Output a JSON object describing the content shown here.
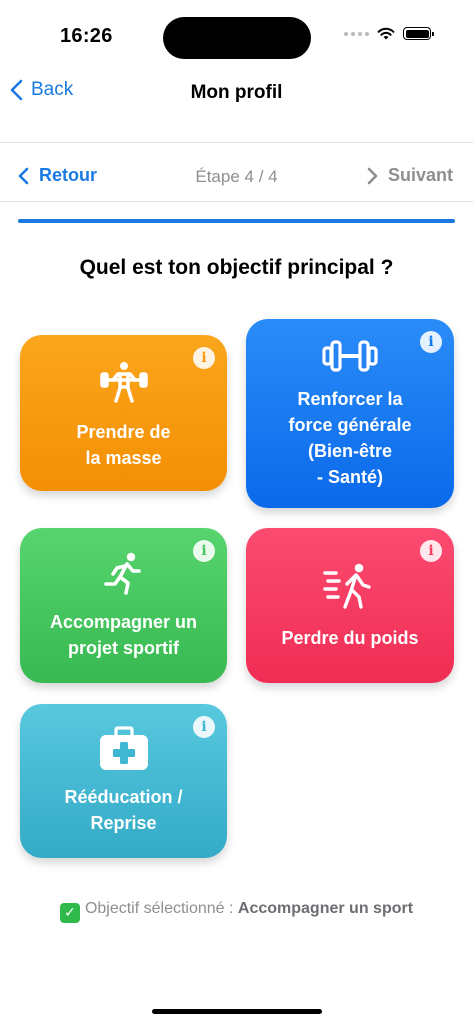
{
  "status_bar": {
    "time": "16:26"
  },
  "nav": {
    "back_label": "Back",
    "title": "Mon profil"
  },
  "stepper": {
    "prev_label": "Retour",
    "step_label": "Étape 4 / 4",
    "next_label": "Suivant",
    "progress": 1.0
  },
  "question": "Quel est ton objectif principal ?",
  "options": [
    {
      "label": "Prendre de\nla masse",
      "icon": "weightlifter-icon",
      "color": "#f7980f"
    },
    {
      "label": "Renforcer la\nforce générale\n(Bien-être\n- Santé)",
      "icon": "dumbbell-icon",
      "color": "#1578ef"
    },
    {
      "label": "Accompagner un\nprojet sportif",
      "icon": "runner-icon",
      "color": "#45c55e"
    },
    {
      "label": "Perdre du poids",
      "icon": "walking-fast-icon",
      "color": "#f53a60"
    },
    {
      "label": "Rééducation /\nReprise",
      "icon": "first-aid-kit-icon",
      "color": "#3fb7d1"
    }
  ],
  "info_glyph": "i",
  "selection": {
    "check": "✓",
    "prefix": "Objectif sélectionné : ",
    "value": "Accompagner un sport"
  }
}
